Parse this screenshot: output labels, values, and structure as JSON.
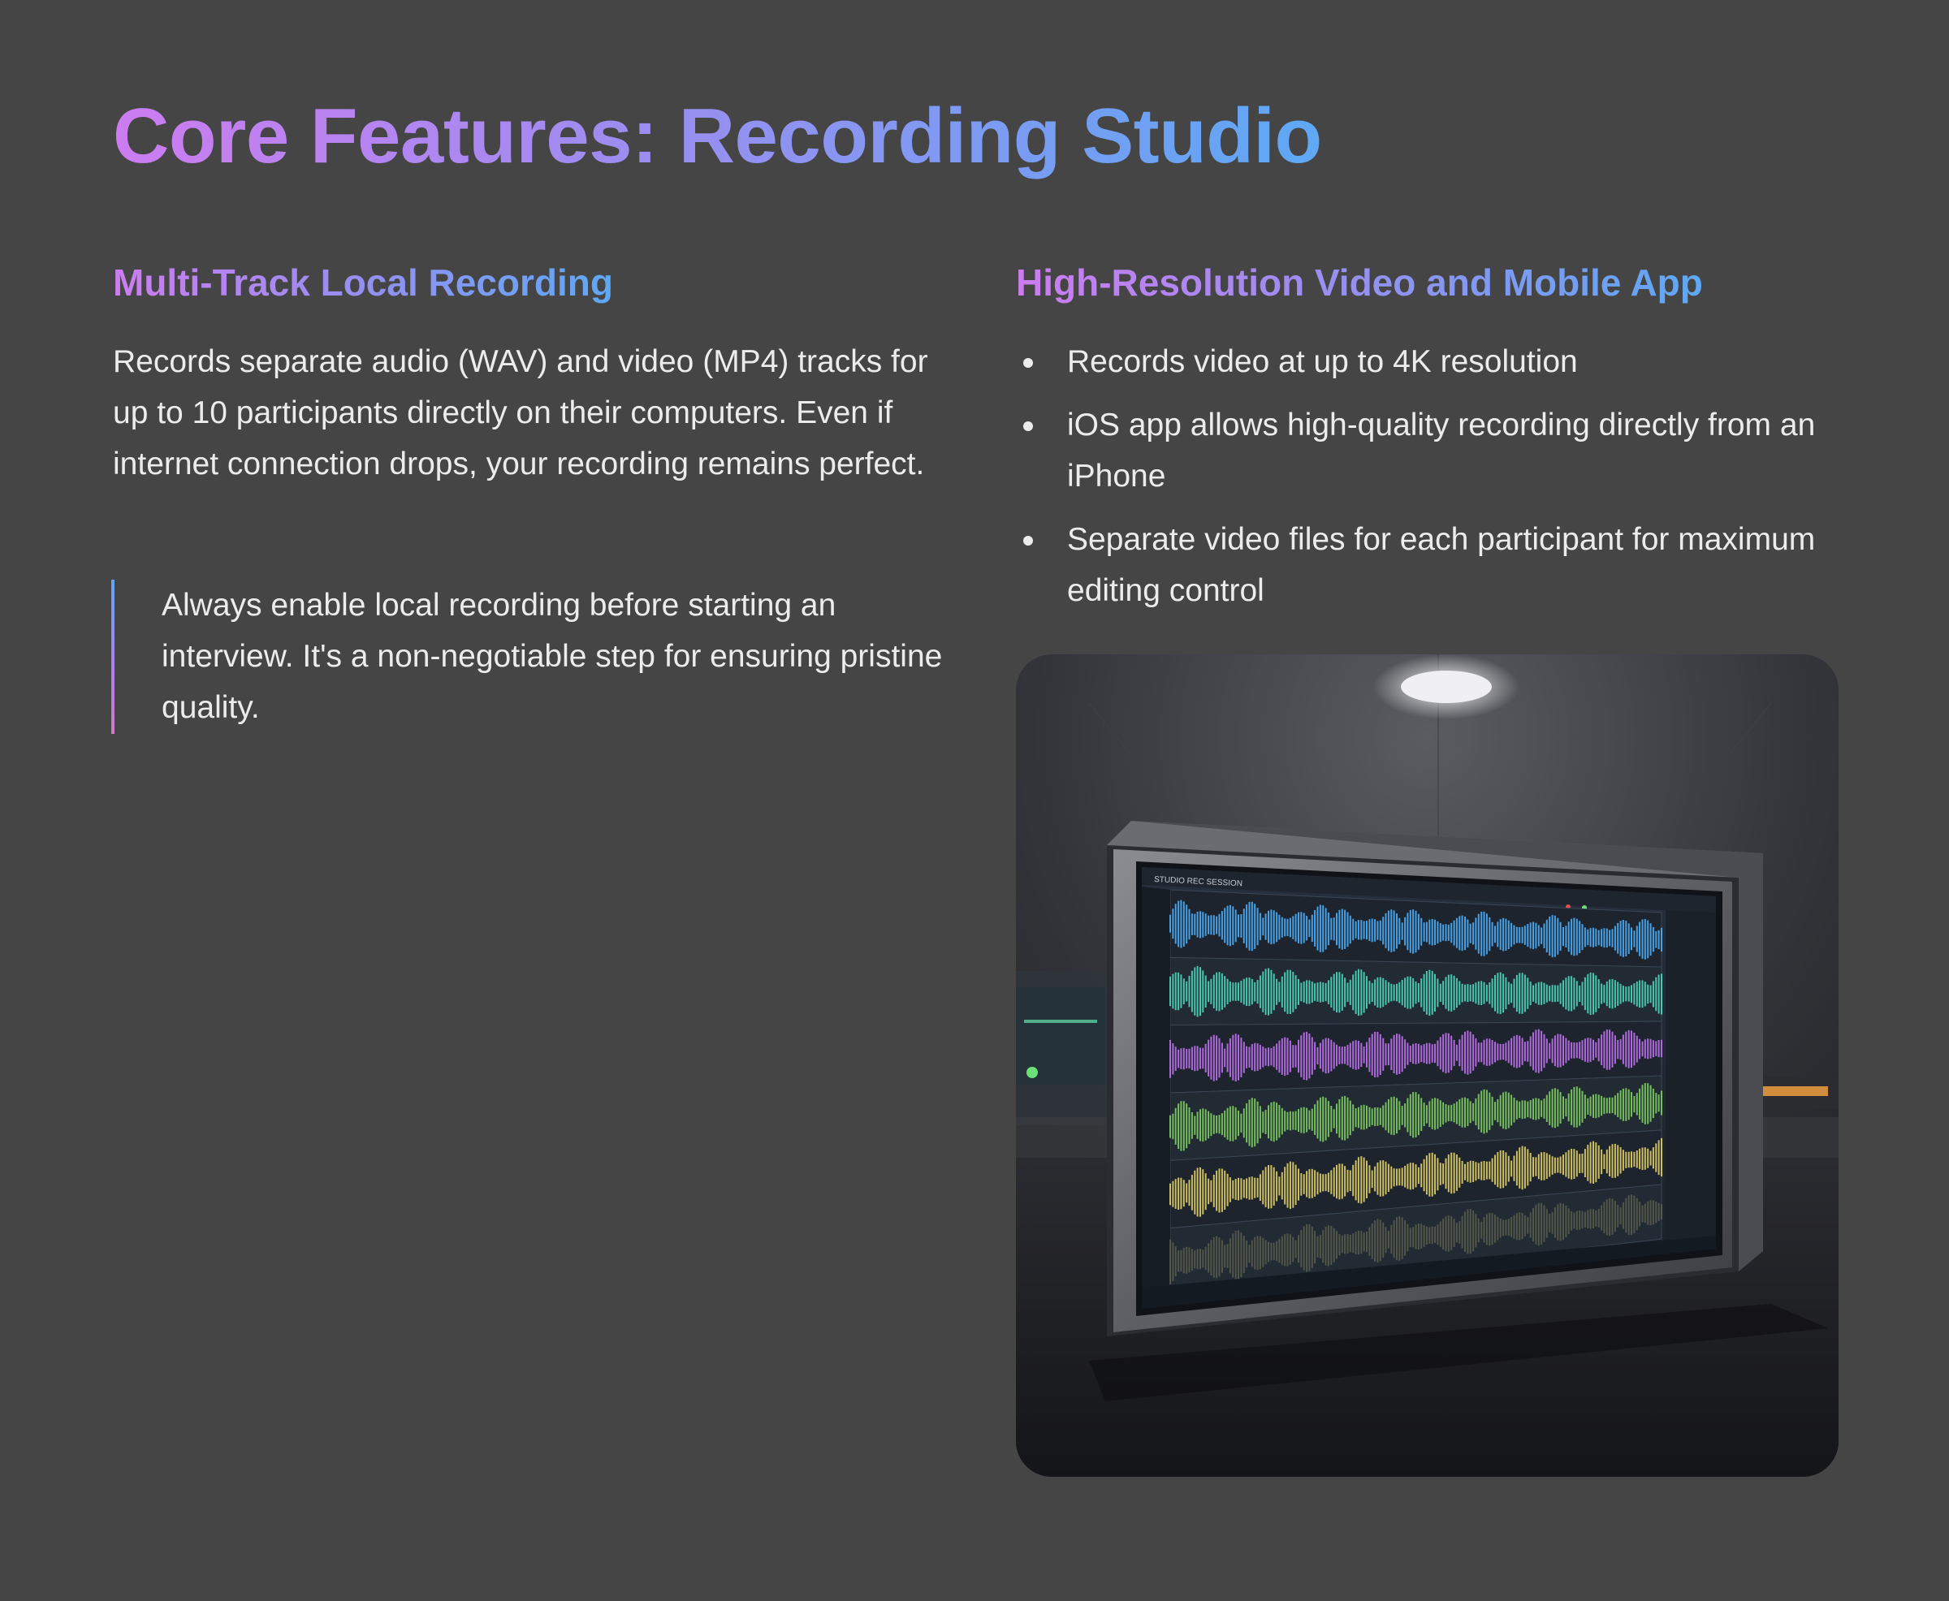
{
  "title": "Core Features: Recording Studio",
  "left": {
    "heading": "Multi-Track Local Recording",
    "body": "Records separate audio (WAV) and video (MP4) tracks for up to 10 participants directly on their computers. Even if internet connection drops, your recording remains perfect.",
    "callout": "Always enable local recording before starting an interview. It's a non-negotiable step for ensuring pristine quality."
  },
  "right": {
    "heading": "High-Resolution Video and Mobile App",
    "bullets": [
      "Records video at up to 4K resolution",
      "iOS app allows high-quality recording directly from an iPhone",
      "Separate video files for each participant for maximum editing control"
    ]
  },
  "image": {
    "screen_label": "STUDIO REC SESSION",
    "track_colors": [
      "#4aa8f0",
      "#4ad0b4",
      "#b86ee8",
      "#7ac860",
      "#d8c864",
      "#7a7a5a"
    ]
  }
}
